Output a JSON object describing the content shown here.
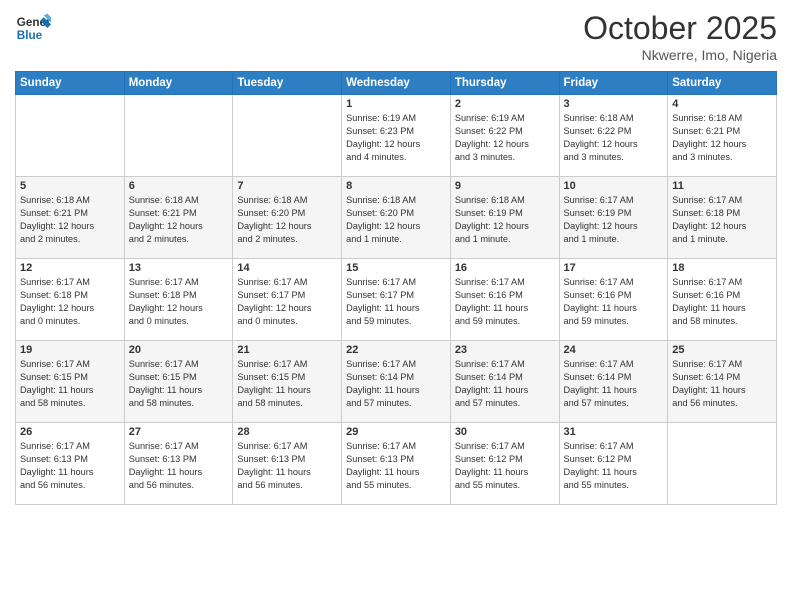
{
  "logo": {
    "line1": "General",
    "line2": "Blue"
  },
  "title": "October 2025",
  "subtitle": "Nkwerre, Imo, Nigeria",
  "headers": [
    "Sunday",
    "Monday",
    "Tuesday",
    "Wednesday",
    "Thursday",
    "Friday",
    "Saturday"
  ],
  "weeks": [
    [
      {
        "day": "",
        "info": ""
      },
      {
        "day": "",
        "info": ""
      },
      {
        "day": "",
        "info": ""
      },
      {
        "day": "1",
        "info": "Sunrise: 6:19 AM\nSunset: 6:23 PM\nDaylight: 12 hours\nand 4 minutes."
      },
      {
        "day": "2",
        "info": "Sunrise: 6:19 AM\nSunset: 6:22 PM\nDaylight: 12 hours\nand 3 minutes."
      },
      {
        "day": "3",
        "info": "Sunrise: 6:18 AM\nSunset: 6:22 PM\nDaylight: 12 hours\nand 3 minutes."
      },
      {
        "day": "4",
        "info": "Sunrise: 6:18 AM\nSunset: 6:21 PM\nDaylight: 12 hours\nand 3 minutes."
      }
    ],
    [
      {
        "day": "5",
        "info": "Sunrise: 6:18 AM\nSunset: 6:21 PM\nDaylight: 12 hours\nand 2 minutes."
      },
      {
        "day": "6",
        "info": "Sunrise: 6:18 AM\nSunset: 6:21 PM\nDaylight: 12 hours\nand 2 minutes."
      },
      {
        "day": "7",
        "info": "Sunrise: 6:18 AM\nSunset: 6:20 PM\nDaylight: 12 hours\nand 2 minutes."
      },
      {
        "day": "8",
        "info": "Sunrise: 6:18 AM\nSunset: 6:20 PM\nDaylight: 12 hours\nand 1 minute."
      },
      {
        "day": "9",
        "info": "Sunrise: 6:18 AM\nSunset: 6:19 PM\nDaylight: 12 hours\nand 1 minute."
      },
      {
        "day": "10",
        "info": "Sunrise: 6:17 AM\nSunset: 6:19 PM\nDaylight: 12 hours\nand 1 minute."
      },
      {
        "day": "11",
        "info": "Sunrise: 6:17 AM\nSunset: 6:18 PM\nDaylight: 12 hours\nand 1 minute."
      }
    ],
    [
      {
        "day": "12",
        "info": "Sunrise: 6:17 AM\nSunset: 6:18 PM\nDaylight: 12 hours\nand 0 minutes."
      },
      {
        "day": "13",
        "info": "Sunrise: 6:17 AM\nSunset: 6:18 PM\nDaylight: 12 hours\nand 0 minutes."
      },
      {
        "day": "14",
        "info": "Sunrise: 6:17 AM\nSunset: 6:17 PM\nDaylight: 12 hours\nand 0 minutes."
      },
      {
        "day": "15",
        "info": "Sunrise: 6:17 AM\nSunset: 6:17 PM\nDaylight: 11 hours\nand 59 minutes."
      },
      {
        "day": "16",
        "info": "Sunrise: 6:17 AM\nSunset: 6:16 PM\nDaylight: 11 hours\nand 59 minutes."
      },
      {
        "day": "17",
        "info": "Sunrise: 6:17 AM\nSunset: 6:16 PM\nDaylight: 11 hours\nand 59 minutes."
      },
      {
        "day": "18",
        "info": "Sunrise: 6:17 AM\nSunset: 6:16 PM\nDaylight: 11 hours\nand 58 minutes."
      }
    ],
    [
      {
        "day": "19",
        "info": "Sunrise: 6:17 AM\nSunset: 6:15 PM\nDaylight: 11 hours\nand 58 minutes."
      },
      {
        "day": "20",
        "info": "Sunrise: 6:17 AM\nSunset: 6:15 PM\nDaylight: 11 hours\nand 58 minutes."
      },
      {
        "day": "21",
        "info": "Sunrise: 6:17 AM\nSunset: 6:15 PM\nDaylight: 11 hours\nand 58 minutes."
      },
      {
        "day": "22",
        "info": "Sunrise: 6:17 AM\nSunset: 6:14 PM\nDaylight: 11 hours\nand 57 minutes."
      },
      {
        "day": "23",
        "info": "Sunrise: 6:17 AM\nSunset: 6:14 PM\nDaylight: 11 hours\nand 57 minutes."
      },
      {
        "day": "24",
        "info": "Sunrise: 6:17 AM\nSunset: 6:14 PM\nDaylight: 11 hours\nand 57 minutes."
      },
      {
        "day": "25",
        "info": "Sunrise: 6:17 AM\nSunset: 6:14 PM\nDaylight: 11 hours\nand 56 minutes."
      }
    ],
    [
      {
        "day": "26",
        "info": "Sunrise: 6:17 AM\nSunset: 6:13 PM\nDaylight: 11 hours\nand 56 minutes."
      },
      {
        "day": "27",
        "info": "Sunrise: 6:17 AM\nSunset: 6:13 PM\nDaylight: 11 hours\nand 56 minutes."
      },
      {
        "day": "28",
        "info": "Sunrise: 6:17 AM\nSunset: 6:13 PM\nDaylight: 11 hours\nand 56 minutes."
      },
      {
        "day": "29",
        "info": "Sunrise: 6:17 AM\nSunset: 6:13 PM\nDaylight: 11 hours\nand 55 minutes."
      },
      {
        "day": "30",
        "info": "Sunrise: 6:17 AM\nSunset: 6:12 PM\nDaylight: 11 hours\nand 55 minutes."
      },
      {
        "day": "31",
        "info": "Sunrise: 6:17 AM\nSunset: 6:12 PM\nDaylight: 11 hours\nand 55 minutes."
      },
      {
        "day": "",
        "info": ""
      }
    ]
  ]
}
